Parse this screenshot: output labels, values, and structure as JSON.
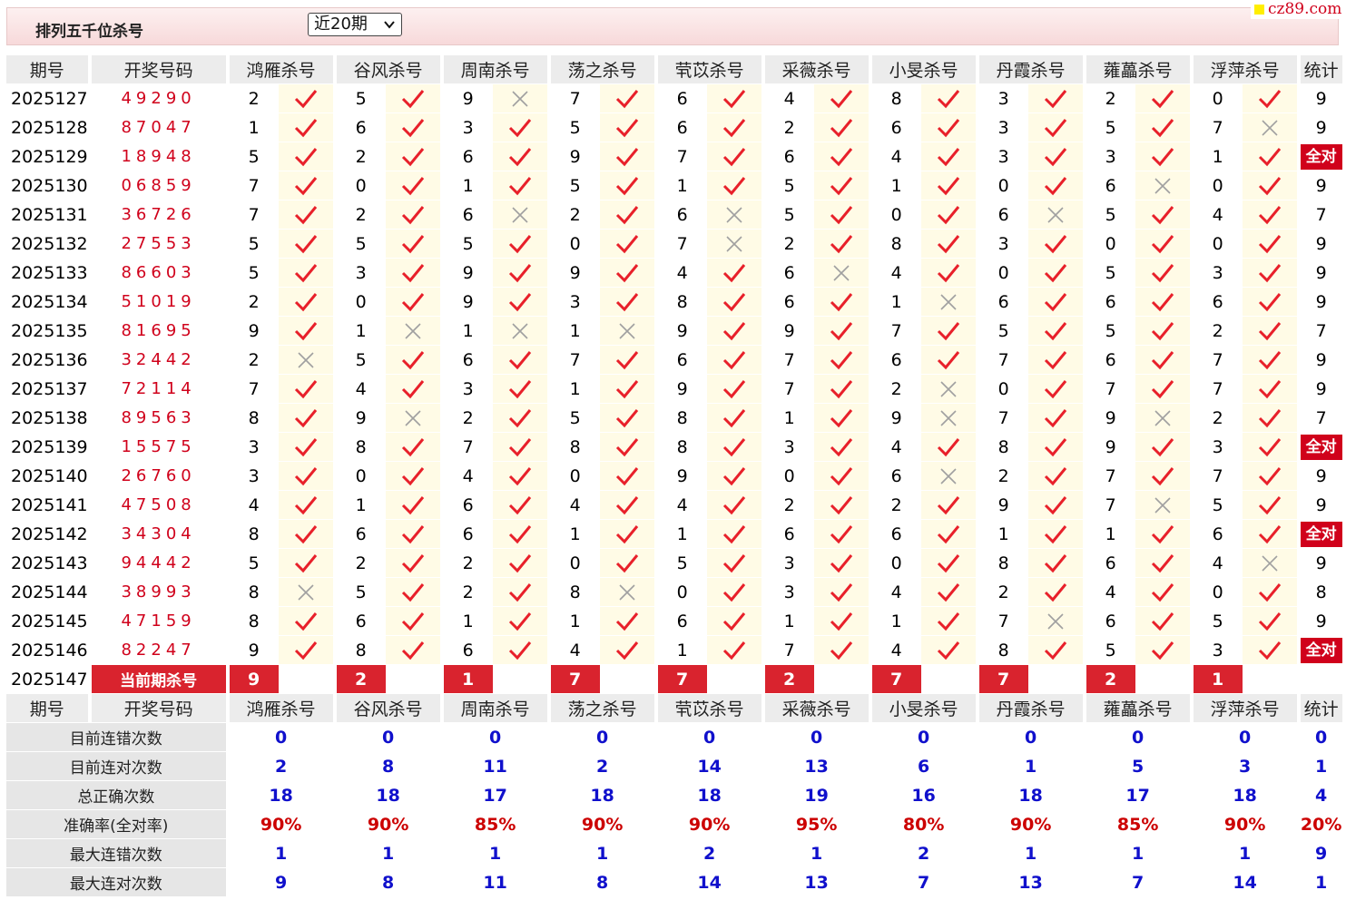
{
  "header": {
    "title": "排列五千位杀号",
    "period_select": "近20期",
    "logo": "cz89.com"
  },
  "columns": {
    "issue": "期号",
    "draw": "开奖号码",
    "stat": "统计",
    "experts": [
      "鸿雁杀号",
      "谷风杀号",
      "周南杀号",
      "荡之杀号",
      "茕苡杀号",
      "采薇杀号",
      "小旻杀号",
      "丹霞杀号",
      "蕹藟杀号",
      "浮萍杀号"
    ]
  },
  "marks": {
    "hit": "✓ (check)",
    "miss": "✕ (cross)",
    "all_correct": "全对"
  },
  "rows": [
    {
      "issue": "2025127",
      "draw": "49290",
      "kills": [
        2,
        5,
        9,
        7,
        6,
        4,
        8,
        3,
        2,
        0
      ],
      "hits": [
        1,
        1,
        0,
        1,
        1,
        1,
        1,
        1,
        1,
        1
      ],
      "stat": "9"
    },
    {
      "issue": "2025128",
      "draw": "87047",
      "kills": [
        1,
        6,
        3,
        5,
        6,
        2,
        6,
        3,
        5,
        7
      ],
      "hits": [
        1,
        1,
        1,
        1,
        1,
        1,
        1,
        1,
        1,
        0
      ],
      "stat": "9"
    },
    {
      "issue": "2025129",
      "draw": "18948",
      "kills": [
        5,
        2,
        6,
        9,
        7,
        6,
        4,
        3,
        3,
        1
      ],
      "hits": [
        1,
        1,
        1,
        1,
        1,
        1,
        1,
        1,
        1,
        1
      ],
      "stat": "全对"
    },
    {
      "issue": "2025130",
      "draw": "06859",
      "kills": [
        7,
        0,
        1,
        5,
        1,
        5,
        1,
        0,
        6,
        0
      ],
      "hits": [
        1,
        1,
        1,
        1,
        1,
        1,
        1,
        1,
        0,
        1
      ],
      "stat": "9"
    },
    {
      "issue": "2025131",
      "draw": "36726",
      "kills": [
        7,
        2,
        6,
        2,
        6,
        5,
        0,
        6,
        5,
        4
      ],
      "hits": [
        1,
        1,
        0,
        1,
        0,
        1,
        1,
        0,
        1,
        1
      ],
      "stat": "7"
    },
    {
      "issue": "2025132",
      "draw": "27553",
      "kills": [
        5,
        5,
        5,
        0,
        7,
        2,
        8,
        3,
        0,
        0
      ],
      "hits": [
        1,
        1,
        1,
        1,
        0,
        1,
        1,
        1,
        1,
        1
      ],
      "stat": "9"
    },
    {
      "issue": "2025133",
      "draw": "86603",
      "kills": [
        5,
        3,
        9,
        9,
        4,
        6,
        4,
        0,
        5,
        3
      ],
      "hits": [
        1,
        1,
        1,
        1,
        1,
        0,
        1,
        1,
        1,
        1
      ],
      "stat": "9"
    },
    {
      "issue": "2025134",
      "draw": "51019",
      "kills": [
        2,
        0,
        9,
        3,
        8,
        6,
        1,
        6,
        6,
        6
      ],
      "hits": [
        1,
        1,
        1,
        1,
        1,
        1,
        0,
        1,
        1,
        1
      ],
      "stat": "9"
    },
    {
      "issue": "2025135",
      "draw": "81695",
      "kills": [
        9,
        1,
        1,
        1,
        9,
        9,
        7,
        5,
        5,
        2
      ],
      "hits": [
        1,
        0,
        0,
        0,
        1,
        1,
        1,
        1,
        1,
        1
      ],
      "stat": "7"
    },
    {
      "issue": "2025136",
      "draw": "32442",
      "kills": [
        2,
        5,
        6,
        7,
        6,
        7,
        6,
        7,
        6,
        7
      ],
      "hits": [
        0,
        1,
        1,
        1,
        1,
        1,
        1,
        1,
        1,
        1
      ],
      "stat": "9"
    },
    {
      "issue": "2025137",
      "draw": "72114",
      "kills": [
        7,
        4,
        3,
        1,
        9,
        7,
        2,
        0,
        7,
        7
      ],
      "hits": [
        1,
        1,
        1,
        1,
        1,
        1,
        0,
        1,
        1,
        1
      ],
      "stat": "9"
    },
    {
      "issue": "2025138",
      "draw": "89563",
      "kills": [
        8,
        9,
        2,
        5,
        8,
        1,
        9,
        7,
        9,
        2
      ],
      "hits": [
        1,
        0,
        1,
        1,
        1,
        1,
        0,
        1,
        0,
        1
      ],
      "stat": "7"
    },
    {
      "issue": "2025139",
      "draw": "15575",
      "kills": [
        3,
        8,
        7,
        8,
        8,
        3,
        4,
        8,
        9,
        3
      ],
      "hits": [
        1,
        1,
        1,
        1,
        1,
        1,
        1,
        1,
        1,
        1
      ],
      "stat": "全对"
    },
    {
      "issue": "2025140",
      "draw": "26760",
      "kills": [
        3,
        0,
        4,
        0,
        9,
        0,
        6,
        2,
        7,
        7
      ],
      "hits": [
        1,
        1,
        1,
        1,
        1,
        1,
        0,
        1,
        1,
        1
      ],
      "stat": "9"
    },
    {
      "issue": "2025141",
      "draw": "47508",
      "kills": [
        4,
        1,
        6,
        4,
        4,
        2,
        2,
        9,
        7,
        5
      ],
      "hits": [
        1,
        1,
        1,
        1,
        1,
        1,
        1,
        1,
        0,
        1
      ],
      "stat": "9"
    },
    {
      "issue": "2025142",
      "draw": "34304",
      "kills": [
        8,
        6,
        6,
        1,
        1,
        6,
        6,
        1,
        1,
        6
      ],
      "hits": [
        1,
        1,
        1,
        1,
        1,
        1,
        1,
        1,
        1,
        1
      ],
      "stat": "全对"
    },
    {
      "issue": "2025143",
      "draw": "94442",
      "kills": [
        5,
        2,
        2,
        0,
        5,
        3,
        0,
        8,
        6,
        4
      ],
      "hits": [
        1,
        1,
        1,
        1,
        1,
        1,
        1,
        1,
        1,
        0
      ],
      "stat": "9"
    },
    {
      "issue": "2025144",
      "draw": "38993",
      "kills": [
        8,
        5,
        2,
        8,
        0,
        3,
        4,
        2,
        4,
        0
      ],
      "hits": [
        0,
        1,
        1,
        0,
        1,
        1,
        1,
        1,
        1,
        1
      ],
      "stat": "8"
    },
    {
      "issue": "2025145",
      "draw": "47159",
      "kills": [
        8,
        6,
        1,
        1,
        6,
        1,
        1,
        7,
        6,
        5
      ],
      "hits": [
        1,
        1,
        1,
        1,
        1,
        1,
        1,
        0,
        1,
        1
      ],
      "stat": "9"
    },
    {
      "issue": "2025146",
      "draw": "82247",
      "kills": [
        9,
        8,
        6,
        4,
        1,
        7,
        4,
        8,
        5,
        3
      ],
      "hits": [
        1,
        1,
        1,
        1,
        1,
        1,
        1,
        1,
        1,
        1
      ],
      "stat": "全对"
    }
  ],
  "current": {
    "issue": "2025147",
    "label": "当前期杀号",
    "kills": [
      9,
      2,
      1,
      7,
      7,
      2,
      7,
      7,
      2,
      1
    ]
  },
  "stats": [
    {
      "label": "目前连错次数",
      "values": [
        0,
        0,
        0,
        0,
        0,
        0,
        0,
        0,
        0,
        0
      ],
      "total": "0",
      "type": "num"
    },
    {
      "label": "目前连对次数",
      "values": [
        2,
        8,
        11,
        2,
        14,
        13,
        6,
        1,
        5,
        3
      ],
      "total": "1",
      "type": "num"
    },
    {
      "label": "总正确次数",
      "values": [
        18,
        18,
        17,
        18,
        18,
        19,
        16,
        18,
        17,
        18
      ],
      "total": "4",
      "type": "num"
    },
    {
      "label": "准确率(全对率)",
      "values": [
        "90%",
        "90%",
        "85%",
        "90%",
        "90%",
        "95%",
        "80%",
        "90%",
        "85%",
        "90%"
      ],
      "total": "20%",
      "type": "rate"
    },
    {
      "label": "最大连错次数",
      "values": [
        1,
        1,
        1,
        1,
        2,
        1,
        2,
        1,
        1,
        1
      ],
      "total": "9",
      "type": "num"
    },
    {
      "label": "最大连对次数",
      "values": [
        9,
        8,
        11,
        8,
        14,
        13,
        7,
        13,
        7,
        14
      ],
      "total": "1",
      "type": "num"
    }
  ]
}
